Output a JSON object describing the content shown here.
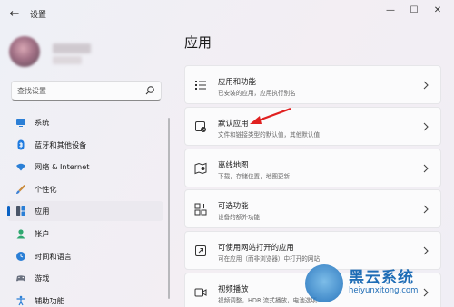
{
  "window": {
    "title": "设置",
    "back_icon": "back-arrow-icon",
    "controls": [
      "minimize-icon",
      "maximize-icon",
      "close-icon"
    ]
  },
  "search": {
    "placeholder": "查找设置"
  },
  "sidebar": {
    "items": [
      {
        "label": "系统",
        "icon": "monitor-icon",
        "active": false
      },
      {
        "label": "蓝牙和其他设备",
        "icon": "bluetooth-icon",
        "active": false
      },
      {
        "label": "网络 & Internet",
        "icon": "wifi-icon",
        "active": false
      },
      {
        "label": "个性化",
        "icon": "brush-icon",
        "active": false
      },
      {
        "label": "应用",
        "icon": "apps-icon",
        "active": true
      },
      {
        "label": "帐户",
        "icon": "person-icon",
        "active": false
      },
      {
        "label": "时间和语言",
        "icon": "globe-clock-icon",
        "active": false
      },
      {
        "label": "游戏",
        "icon": "gamepad-icon",
        "active": false
      },
      {
        "label": "辅助功能",
        "icon": "accessibility-icon",
        "active": false
      }
    ]
  },
  "main": {
    "title": "应用",
    "cards": [
      {
        "title": "应用和功能",
        "subtitle": "已安装的应用，应用执行别名",
        "icon": "list-icon"
      },
      {
        "title": "默认应用",
        "subtitle": "文件和链接类型的默认值，其他默认值",
        "icon": "default-app-icon"
      },
      {
        "title": "离线地图",
        "subtitle": "下载，存储位置，地图更新",
        "icon": "map-icon"
      },
      {
        "title": "可选功能",
        "subtitle": "设备的额外功能",
        "icon": "grid-plus-icon"
      },
      {
        "title": "可使用网站打开的应用",
        "subtitle": "可在应用（而非浏览器）中打开的网站",
        "icon": "open-web-icon"
      },
      {
        "title": "视频播放",
        "subtitle": "视频调整，HDR 流式播放，电池选项",
        "icon": "video-icon"
      }
    ]
  },
  "annotation": {
    "color": "#e02020"
  },
  "watermark": {
    "title": "黑云系统",
    "url": "heiyunxitong.com"
  },
  "colors": {
    "accent": "#0a62c4",
    "watermark": "#1f6db6"
  }
}
